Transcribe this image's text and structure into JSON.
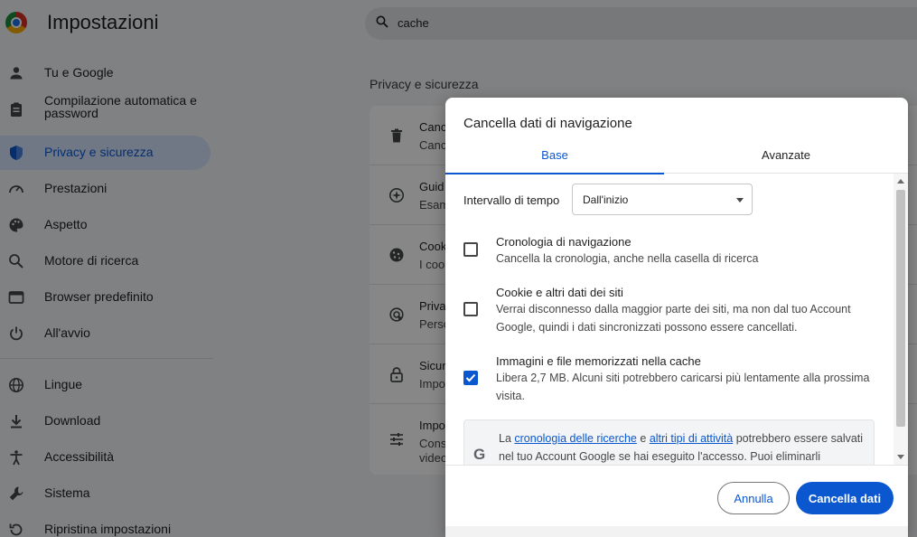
{
  "app": {
    "title": "Impostazioni",
    "logo": "chrome-logo-icon"
  },
  "search": {
    "value": "cache",
    "icon": "search-icon"
  },
  "sidebar": {
    "items": [
      {
        "label": "Tu e Google",
        "icon": "person-icon"
      },
      {
        "label": "Compilazione automatica e password",
        "icon": "clipboard-icon"
      },
      {
        "label": "Privacy e sicurezza",
        "icon": "shield-icon",
        "active": true
      },
      {
        "label": "Prestazioni",
        "icon": "speedometer-icon"
      },
      {
        "label": "Aspetto",
        "icon": "palette-icon"
      },
      {
        "label": "Motore di ricerca",
        "icon": "search-icon"
      },
      {
        "label": "Browser predefinito",
        "icon": "browser-icon"
      },
      {
        "label": "All'avvio",
        "icon": "power-icon"
      },
      {
        "label": "Lingue",
        "icon": "globe-icon"
      },
      {
        "label": "Download",
        "icon": "download-icon"
      },
      {
        "label": "Accessibilità",
        "icon": "accessibility-icon"
      },
      {
        "label": "Sistema",
        "icon": "wrench-icon"
      },
      {
        "label": "Ripristina impostazioni",
        "icon": "restore-icon"
      }
    ]
  },
  "main": {
    "section_title": "Privacy e sicurezza",
    "rows": [
      {
        "line1": "Canc",
        "line2": "Canc",
        "icon": "trash-icon"
      },
      {
        "line1": "Guid",
        "line2": "Esam",
        "icon": "compass-icon"
      },
      {
        "line1": "Cook",
        "line2": "I coo",
        "icon": "cookie-icon"
      },
      {
        "line1": "Priva",
        "line2": "Perso",
        "icon": "ads-privacy-icon"
      },
      {
        "line1": "Sicur",
        "line2": "Impo",
        "icon": "lock-icon"
      },
      {
        "line1": "Impo",
        "line2": "Cons",
        "line3": "video",
        "icon": "sliders-icon"
      }
    ]
  },
  "dialog": {
    "title": "Cancella dati di navigazione",
    "tabs": [
      {
        "label": "Base",
        "selected": true
      },
      {
        "label": "Avanzate",
        "selected": false
      }
    ],
    "time_range": {
      "label": "Intervallo di tempo",
      "value": "Dall'inizio"
    },
    "options": [
      {
        "title": "Cronologia di navigazione",
        "description": "Cancella la cronologia, anche nella casella di ricerca",
        "checked": false
      },
      {
        "title": "Cookie e altri dati dei siti",
        "description": "Verrai disconnesso dalla maggior parte dei siti, ma non dal tuo Account Google, quindi i dati sincronizzati possono essere cancellati.",
        "checked": false
      },
      {
        "title": "Immagini e file memorizzati nella cache",
        "description": "Libera 2,7 MB. Alcuni siti potrebbero caricarsi più lentamente alla prossima visita.",
        "checked": true
      }
    ],
    "info": {
      "icon": "google-g-icon",
      "glyph": "G",
      "prefix": "La",
      "link1": "cronologia delle ricerche",
      "mid": "e",
      "link2": "altri tipi di attività",
      "suffix": "potrebbero essere salvati nel tuo Account Google se hai eseguito l'accesso. Puoi eliminarli"
    },
    "buttons": {
      "cancel": "Annulla",
      "confirm": "Cancella dati"
    }
  },
  "colors": {
    "accent": "#0b57d0",
    "active_nav_bg": "#d3e3fd",
    "scrim": "rgba(0,0,0,0.47)"
  }
}
